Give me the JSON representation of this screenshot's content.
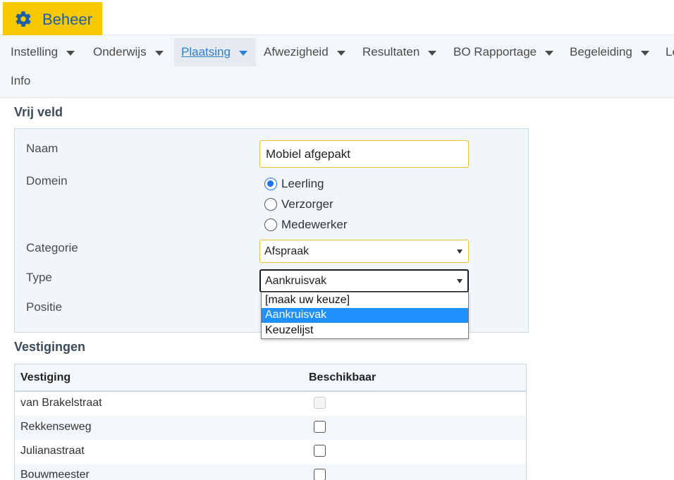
{
  "header": {
    "active_module": "Beheer",
    "gear_icon": "gear-icon"
  },
  "nav": {
    "items": [
      {
        "label": "Instelling"
      },
      {
        "label": "Onderwijs"
      },
      {
        "label": "Plaatsing"
      },
      {
        "label": "Afwezigheid"
      },
      {
        "label": "Resultaten"
      },
      {
        "label": "BO Rapportage"
      },
      {
        "label": "Begeleiding"
      },
      {
        "label": "Le"
      }
    ],
    "active": "Plaatsing",
    "info": "Info"
  },
  "form": {
    "title": "Vrij veld",
    "naam_label": "Naam",
    "naam_value": "Mobiel afgepakt",
    "domein_label": "Domein",
    "domein_options": [
      "Leerling",
      "Verzorger",
      "Medewerker"
    ],
    "domein_selected": "Leerling",
    "categorie_label": "Categorie",
    "categorie_value": "Afspraak",
    "type_label": "Type",
    "type_value": "Aankruisvak",
    "positie_label": "Positie",
    "type_dropdown_options": [
      "[maak uw keuze]",
      "Aankruisvak",
      "Keuzelijst"
    ],
    "type_dropdown_highlighted": "Aankruisvak"
  },
  "vestigingen": {
    "title": "Vestigingen",
    "columns": [
      "Vestiging",
      "Beschikbaar"
    ],
    "rows": [
      {
        "name": "van Brakelstraat",
        "available": false,
        "disabled": true
      },
      {
        "name": "Rekkenseweg",
        "available": false,
        "disabled": false
      },
      {
        "name": "Julianastraat",
        "available": false,
        "disabled": false
      },
      {
        "name": "Bouwmeester",
        "available": false,
        "disabled": false
      }
    ]
  },
  "colors": {
    "accent_yellow": "#f5c800",
    "link_blue": "#2b7fd6",
    "highlight_blue": "#1e90ff"
  }
}
